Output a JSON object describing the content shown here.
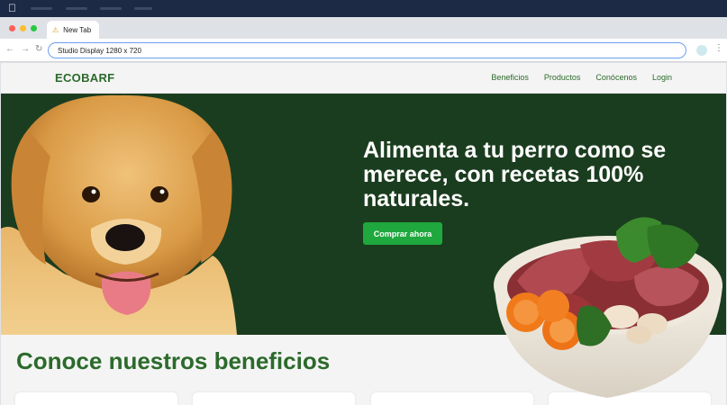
{
  "browser": {
    "tab_title": "New Tab",
    "address": "Studio Display   1280 x 720"
  },
  "site": {
    "logo": "ECOBARF",
    "nav": [
      "Beneficios",
      "Productos",
      "Conócenos",
      "Login"
    ]
  },
  "hero": {
    "title": "Alimenta a tu perro como se merece, con recetas 100% naturales.",
    "cta": "Comprar ahora"
  },
  "benefits": {
    "title": "Conoce nuestros beneficios"
  },
  "colors": {
    "brand_green": "#2b6a2b",
    "hero_bg": "#1b3d1f",
    "cta_green": "#1fa83d"
  }
}
